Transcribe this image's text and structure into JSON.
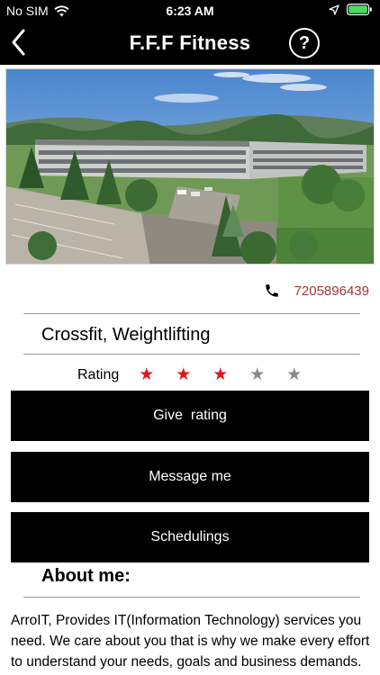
{
  "status_bar": {
    "carrier": "No SIM",
    "time": "6:23 AM"
  },
  "nav": {
    "title": "F.F.F Fitness",
    "help_label": "?"
  },
  "contact": {
    "phone": "7205896439"
  },
  "listing": {
    "categories": "Crossfit, Weightlifting",
    "rating_label": "Rating",
    "rating": 3,
    "rating_max": 5,
    "star_filled_color": "#e01818",
    "star_empty_color": "#8a8a8a"
  },
  "actions": {
    "give_rating": "Give  rating",
    "message_me": "Message me",
    "schedulings": "Schedulings"
  },
  "about": {
    "heading": "About me:",
    "text": "ArroIT, Provides IT(Information Technology) services you need. We care about you that is why we make every effort to understand your needs, goals and business demands. We are committed to provide the highest level"
  },
  "icons": {
    "back": "chevron-left-icon",
    "help": "question-circle-icon",
    "phone": "phone-icon",
    "wifi": "wifi-icon",
    "location": "location-arrow-icon",
    "battery": "battery-icon"
  },
  "colors": {
    "bars": "#000000",
    "phone_text": "#a83232",
    "battery_fill": "#4cd964"
  }
}
